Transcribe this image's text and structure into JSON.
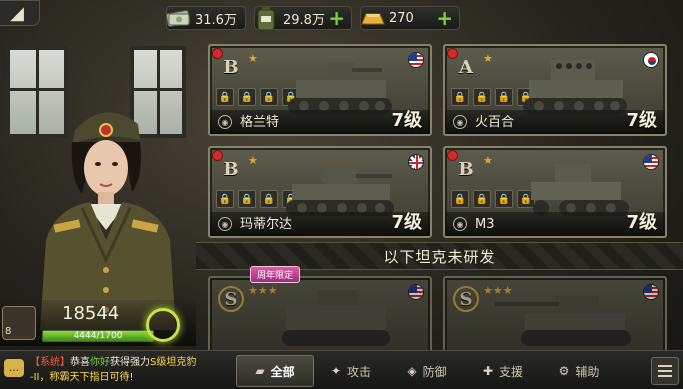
{
  "resources": {
    "cash": {
      "value": "31.6万",
      "icon": "cash-icon"
    },
    "fuel": {
      "value": "29.8万",
      "icon": "fuel-can-icon"
    },
    "gold": {
      "value": "270",
      "icon": "gold-bar-icon"
    },
    "accent_plus": "#7fd13a"
  },
  "tanks": [
    {
      "rank": "B",
      "stars": "★",
      "name": "格兰特",
      "level": "7级",
      "flag": "us",
      "selected_dot": true
    },
    {
      "rank": "A",
      "stars": "★",
      "name": "火百合",
      "level": "7级",
      "flag": "kr",
      "selected_dot": true
    },
    {
      "rank": "B",
      "stars": "★",
      "name": "玛蒂尔达",
      "level": "7级",
      "flag": "gb",
      "selected_dot": true
    },
    {
      "rank": "B",
      "stars": "★",
      "name": "M3",
      "level": "7级",
      "flag": "us",
      "selected_dot": true
    }
  ],
  "section_title": "以下坦克未研发",
  "locked_tanks": [
    {
      "rank": "S",
      "stars": "★★★",
      "badge": "周年限定",
      "flag": "us"
    },
    {
      "rank": "S",
      "stars": "★★★",
      "flag": "us"
    }
  ],
  "player": {
    "power": "18544",
    "exp_text": "4444/1700",
    "exp_fraction": 1.0,
    "medal_level": "8"
  },
  "chat": {
    "tag": "【系统】",
    "pre": "恭喜",
    "player": "你好",
    "mid": "获得强力",
    "item": "S级坦克豹",
    "tail": "-II，称霸天下指日可待!"
  },
  "tabs": [
    {
      "label": "全部",
      "icon": "tank-icon",
      "active": true
    },
    {
      "label": "攻击",
      "icon": "attack-icon",
      "active": false
    },
    {
      "label": "防御",
      "icon": "shield-icon",
      "active": false
    },
    {
      "label": "支援",
      "icon": "support-icon",
      "active": false
    },
    {
      "label": "辅助",
      "icon": "wrench-icon",
      "active": false
    }
  ]
}
